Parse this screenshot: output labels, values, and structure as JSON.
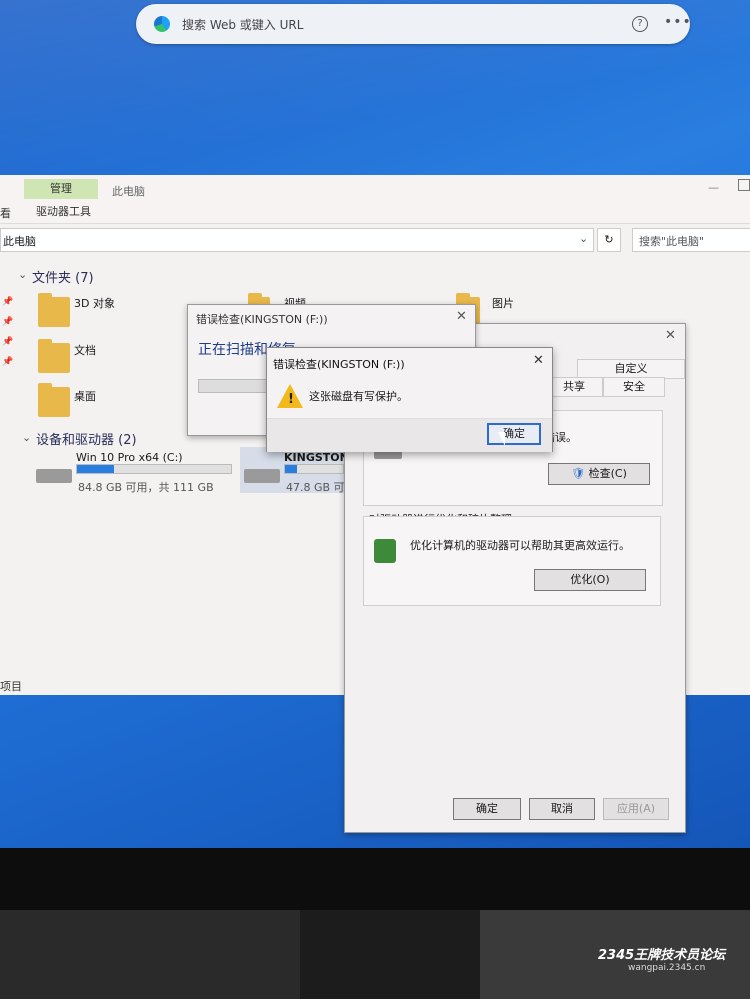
{
  "browser": {
    "url_placeholder": "搜索 Web 或键入 URL",
    "help": "?",
    "more": "•••"
  },
  "explorer": {
    "ribbon_tab_manage": "管理",
    "ribbon_title": "此电脑",
    "ribbon_tab_view": "看",
    "ribbon_tab_drivetools": "驱动器工具",
    "address": "此电脑",
    "search_placeholder": "搜索\"此电脑\"",
    "section_folders": "文件夹 (7)",
    "folders": [
      {
        "label": "3D 对象"
      },
      {
        "label": "视频"
      },
      {
        "label": "图片"
      },
      {
        "label": "文档"
      },
      {
        "label": "桌面"
      }
    ],
    "section_devices": "设备和驱动器 (2)",
    "drives": [
      {
        "name": "Win 10 Pro x64 (C:)",
        "space": "84.8 GB 可用，共 111 GB",
        "used_fraction": 0.24
      },
      {
        "name": "KINGSTON",
        "space": "47.8 GB 可用，",
        "used_fraction": 0.2
      }
    ],
    "status": "项目"
  },
  "properties": {
    "tabs_row1": [
      "自定义"
    ],
    "tabs_row2": [
      "共享",
      "安全"
    ],
    "check_text": "错误。",
    "check_button": "检查(C)",
    "optimize_group": "对驱动器进行优化和碎片整理",
    "optimize_text": "优化计算机的驱动器可以帮助其更高效运行。",
    "optimize_button": "优化(O)",
    "ok": "确定",
    "cancel": "取消",
    "apply": "应用(A)"
  },
  "scan_dialog": {
    "title": "错误检查(KINGSTON (F:))",
    "heading": "正在扫描和修复"
  },
  "alert": {
    "title": "错误检查(KINGSTON (F:))",
    "message": "这张磁盘有写保护。",
    "ok": "确定"
  },
  "watermark": {
    "brand": "2345王牌技术员论坛",
    "site": "wangpai.2345.cn"
  }
}
